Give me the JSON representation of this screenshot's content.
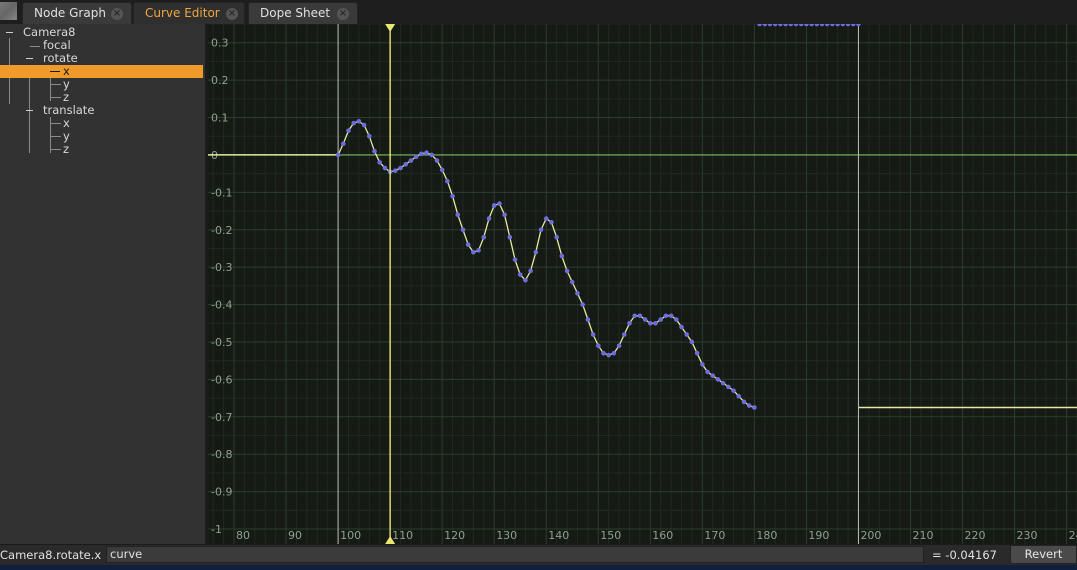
{
  "tabs": [
    {
      "label": "Node Graph",
      "close": "×",
      "active": false
    },
    {
      "label": "Curve Editor",
      "close": "×",
      "active": true
    },
    {
      "label": "Dope Sheet",
      "close": "×",
      "active": false
    }
  ],
  "tree": {
    "root": {
      "label": "Camera8",
      "expander": "−"
    },
    "focal": {
      "label": "focal"
    },
    "rotate": {
      "label": "rotate",
      "expander": "−",
      "children": [
        "x",
        "y",
        "z"
      ],
      "selected": "x"
    },
    "translate": {
      "label": "translate",
      "expander": "−",
      "children": [
        "x",
        "y",
        "z"
      ]
    }
  },
  "graph": {
    "y_ticks": [
      "0.3",
      "0.2",
      "0.1",
      "0",
      "-0.1",
      "-0.2",
      "-0.3",
      "-0.4",
      "-0.5",
      "-0.6",
      "-0.7",
      "-0.8",
      "-0.9",
      "-1"
    ],
    "x_ticks": [
      "80",
      "90",
      "100",
      "110",
      "120",
      "130",
      "140",
      "150",
      "160",
      "170",
      "180",
      "190",
      "200",
      "210",
      "220",
      "230",
      "240"
    ],
    "current_frame": 110,
    "frame_range": [
      100,
      200
    ],
    "colors": {
      "background": "#151a15",
      "grid": "#2d3d2d",
      "zero_line": "#7fbf5f",
      "curve": "#e8e8a0",
      "keys": "#6d6ddc",
      "current_frame": "#e8e870",
      "text": "#8fa08f"
    }
  },
  "chart_data": {
    "type": "line",
    "xlim": [
      75,
      242
    ],
    "ylim": [
      -1.04,
      0.35
    ],
    "x": [
      100,
      101,
      102,
      103,
      104,
      105,
      106,
      107,
      108,
      109,
      110,
      111,
      112,
      113,
      114,
      115,
      116,
      117,
      118,
      119,
      120,
      121,
      122,
      123,
      124,
      125,
      126,
      127,
      128,
      129,
      130,
      131,
      132,
      133,
      134,
      135,
      136,
      137,
      138,
      139,
      140,
      141,
      142,
      143,
      144,
      145,
      146,
      147,
      148,
      149,
      150,
      151,
      152,
      153,
      154,
      155,
      156,
      157,
      158,
      159,
      160,
      161,
      162,
      163,
      164,
      165,
      166,
      167,
      168,
      169,
      170,
      171,
      172,
      173,
      174,
      175,
      176,
      177,
      178,
      179,
      180,
      181,
      182,
      183,
      184,
      185,
      186,
      187,
      188,
      189,
      190,
      191,
      192,
      193,
      194,
      195,
      196,
      197,
      198,
      199,
      200
    ],
    "values": [
      0.0,
      0.03,
      0.065,
      0.085,
      0.09,
      0.08,
      0.05,
      0.01,
      -0.02,
      -0.035,
      -0.045,
      -0.042,
      -0.035,
      -0.025,
      -0.015,
      -0.005,
      0.003,
      0.006,
      0.0,
      -0.015,
      -0.04,
      -0.07,
      -0.11,
      -0.16,
      -0.2,
      -0.24,
      -0.26,
      -0.255,
      -0.22,
      -0.17,
      -0.135,
      -0.13,
      -0.16,
      -0.22,
      -0.28,
      -0.32,
      -0.335,
      -0.31,
      -0.26,
      -0.2,
      -0.17,
      -0.18,
      -0.22,
      -0.27,
      -0.31,
      -0.34,
      -0.37,
      -0.4,
      -0.44,
      -0.48,
      -0.51,
      -0.53,
      -0.535,
      -0.53,
      -0.51,
      -0.48,
      -0.45,
      -0.43,
      -0.43,
      -0.44,
      -0.45,
      -0.45,
      -0.44,
      -0.43,
      -0.43,
      -0.44,
      -0.46,
      -0.48,
      -0.5,
      -0.53,
      -0.56,
      -0.58,
      -0.59,
      -0.6,
      -0.61,
      -0.62,
      -0.63,
      -0.645,
      -0.66,
      -0.67,
      -0.675
    ],
    "pre_value": 0.0,
    "post_value": -0.675
  },
  "bottom": {
    "curve_name": "Camera8.rotate.x",
    "expression": "curve",
    "value": "= -0.04167",
    "revert_label": "Revert"
  }
}
